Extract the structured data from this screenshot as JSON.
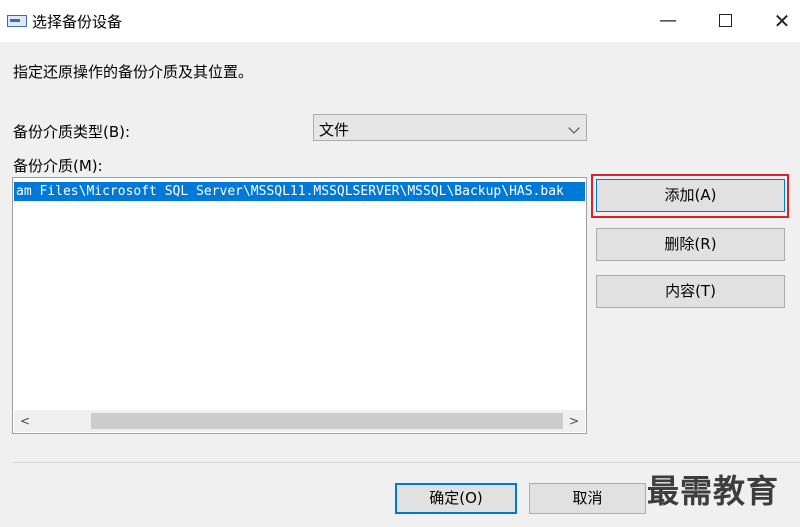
{
  "window": {
    "title": "选择备份设备",
    "minimize_glyph": "—",
    "close_glyph": "✕"
  },
  "instruction": "指定还原操作的备份介质及其位置。",
  "media_type": {
    "label": "备份介质类型(B):",
    "selected": "文件"
  },
  "media_list": {
    "label": "备份介质(M):",
    "items": [
      "am Files\\Microsoft SQL Server\\MSSQL11.MSSQLSERVER\\MSSQL\\Backup\\HAS.bak"
    ],
    "scroll_left_glyph": "<",
    "scroll_right_glyph": ">"
  },
  "buttons": {
    "add": "添加(A)",
    "remove": "删除(R)",
    "contents": "内容(T)",
    "ok": "确定(O)",
    "cancel": "取消"
  },
  "highlight_color": "#d9232b",
  "accent_color": "#0078d7",
  "watermark": "最需教育"
}
